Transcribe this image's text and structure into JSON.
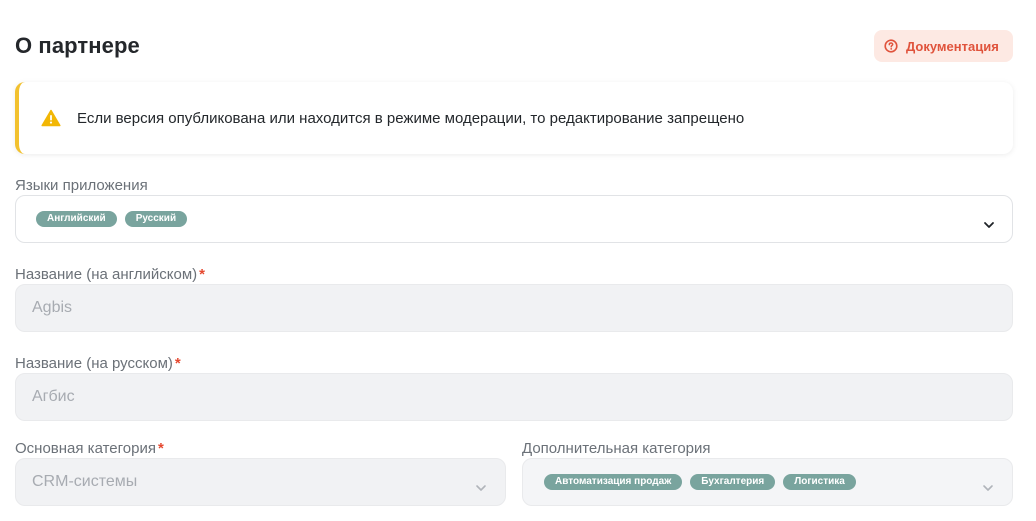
{
  "header": {
    "title": "О партнере",
    "doc_button_label": "Документация"
  },
  "alert": {
    "text": "Если версия опубликована или находится в режиме модерации, то редактирование запрещено"
  },
  "form": {
    "languages": {
      "label": "Языки приложения",
      "chips": [
        "Английский",
        "Русский"
      ]
    },
    "name_en": {
      "label": "Название (на английском)",
      "required_mark": "*",
      "value": "Agbis"
    },
    "name_ru": {
      "label": "Название (на русском)",
      "required_mark": "*",
      "value": "Агбис"
    },
    "main_category": {
      "label": "Основная категория",
      "required_mark": "*",
      "value": "CRM-системы"
    },
    "extra_category": {
      "label": "Дополнительная категория",
      "chips": [
        "Автоматизация продаж",
        "Бухгалтерия",
        "Логистика"
      ]
    }
  },
  "colors": {
    "accent_red": "#e0533c",
    "doc_button_bg": "#fde9e3",
    "alert_border": "#f2c12e",
    "chip_bg": "#79a49e"
  },
  "icons": {
    "doc_button": "question-circle-icon",
    "alert": "warning-triangle-icon",
    "select": "chevron-down-icon"
  }
}
